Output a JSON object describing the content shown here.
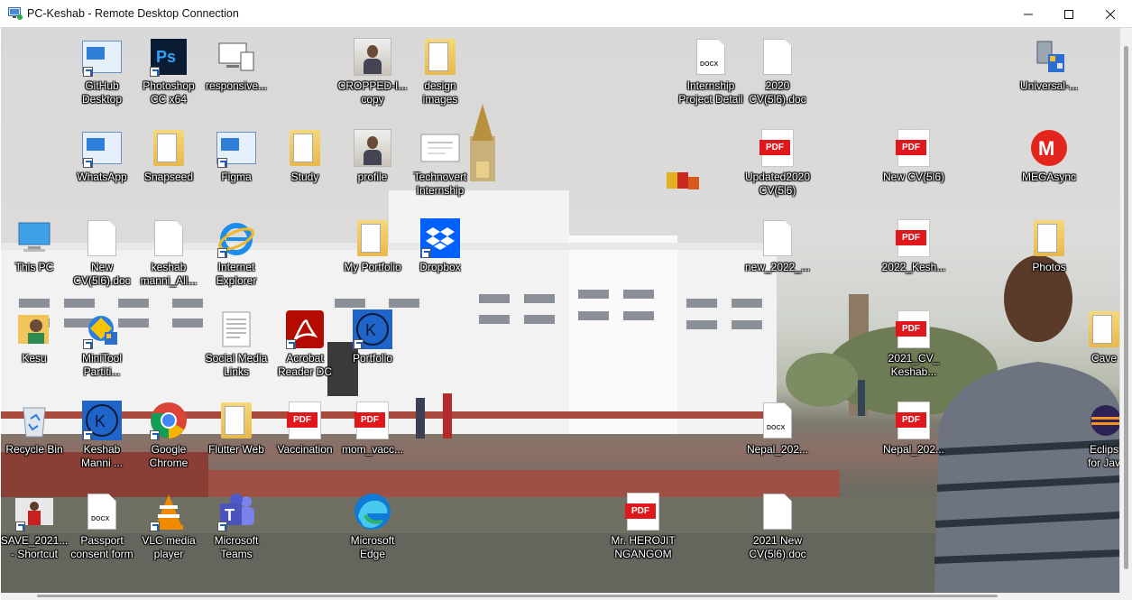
{
  "window": {
    "title": "PC-Keshab - Remote Desktop Connection",
    "controls": {
      "minimize": "–",
      "maximize": "☐",
      "close": "✕"
    }
  },
  "desktop": {
    "icons": [
      {
        "label": "GitHub\nDesktop",
        "icon": "app-window-icon"
      },
      {
        "label": "Photoshop\nCC x64",
        "icon": "photoshop-icon"
      },
      {
        "label": "responsive...",
        "icon": "devices-icon"
      },
      {
        "label": "CROPPED-I...\ncopy",
        "icon": "photo-icon"
      },
      {
        "label": "design\nimages",
        "icon": "folder-icon"
      },
      {
        "label": "Internship\nProject Detail",
        "icon": "docx-icon"
      },
      {
        "label": "2020\nCV(5l6).doc",
        "icon": "document-icon"
      },
      {
        "label": "Universal-...",
        "icon": "usb-installer-icon"
      },
      {
        "label": "WhatsApp",
        "icon": "app-window-icon"
      },
      {
        "label": "Snapseed",
        "icon": "folder-icon"
      },
      {
        "label": "Figma",
        "icon": "app-window-icon"
      },
      {
        "label": "Study",
        "icon": "folder-icon"
      },
      {
        "label": "profile",
        "icon": "photo-icon"
      },
      {
        "label": "Technovert\nInternship",
        "icon": "certificate-icon"
      },
      {
        "label": "Updated2020\nCV(5l6)",
        "icon": "pdf-icon"
      },
      {
        "label": "New CV(5l6)",
        "icon": "pdf-icon"
      },
      {
        "label": "MEGAsync",
        "icon": "mega-icon"
      },
      {
        "label": "This PC",
        "icon": "computer-icon"
      },
      {
        "label": "New\nCV(5l6).doc",
        "icon": "document-icon"
      },
      {
        "label": "keshab\nmanni_All...",
        "icon": "document-icon"
      },
      {
        "label": "Internet\nExplorer",
        "icon": "internet-explorer-icon"
      },
      {
        "label": "My Portfolio",
        "icon": "folder-icon"
      },
      {
        "label": "Dropbox",
        "icon": "dropbox-icon"
      },
      {
        "label": "new_2022_...",
        "icon": "document-icon"
      },
      {
        "label": "2022_Kesh...",
        "icon": "pdf-icon"
      },
      {
        "label": "Photos",
        "icon": "folder-icon"
      },
      {
        "label": "Kesu",
        "icon": "user-folder-icon"
      },
      {
        "label": "MiniTool\nPartiti...",
        "icon": "minitool-icon"
      },
      {
        "label": "Social Media\nLinks",
        "icon": "text-file-icon"
      },
      {
        "label": "Acrobat\nReader DC",
        "icon": "acrobat-icon"
      },
      {
        "label": "Portfolio",
        "icon": "portfolio-logo-icon"
      },
      {
        "label": "2021_CV_\nKeshab...",
        "icon": "pdf-icon"
      },
      {
        "label": "Cave",
        "icon": "folder-icon"
      },
      {
        "label": "Recycle Bin",
        "icon": "recycle-bin-icon"
      },
      {
        "label": "Keshab\nManni ...",
        "icon": "portfolio-logo-icon"
      },
      {
        "label": "Google\nChrome",
        "icon": "chrome-icon"
      },
      {
        "label": "Flutter Web",
        "icon": "folder-icon"
      },
      {
        "label": "Vaccination",
        "icon": "pdf-icon"
      },
      {
        "label": "mom_vacc...",
        "icon": "pdf-icon"
      },
      {
        "label": "Nepal_202...",
        "icon": "docx-icon"
      },
      {
        "label": "Nepal_202...",
        "icon": "pdf-icon"
      },
      {
        "label": "Eclips\nfor Jav",
        "icon": "eclipse-icon"
      },
      {
        "label": "SAVE_2021...\n- Shortcut",
        "icon": "photo-icon"
      },
      {
        "label": "Passport\nconsent form",
        "icon": "docx-icon"
      },
      {
        "label": "VLC media\nplayer",
        "icon": "vlc-icon"
      },
      {
        "label": "Microsoft\nTeams",
        "icon": "teams-icon"
      },
      {
        "label": "Microsoft\nEdge",
        "icon": "edge-icon"
      },
      {
        "label": "Mr. HEROJIT\nNGANGOM",
        "icon": "pdf-icon"
      },
      {
        "label": "2021 New\nCV(5l6).doc",
        "icon": "document-icon"
      }
    ]
  }
}
